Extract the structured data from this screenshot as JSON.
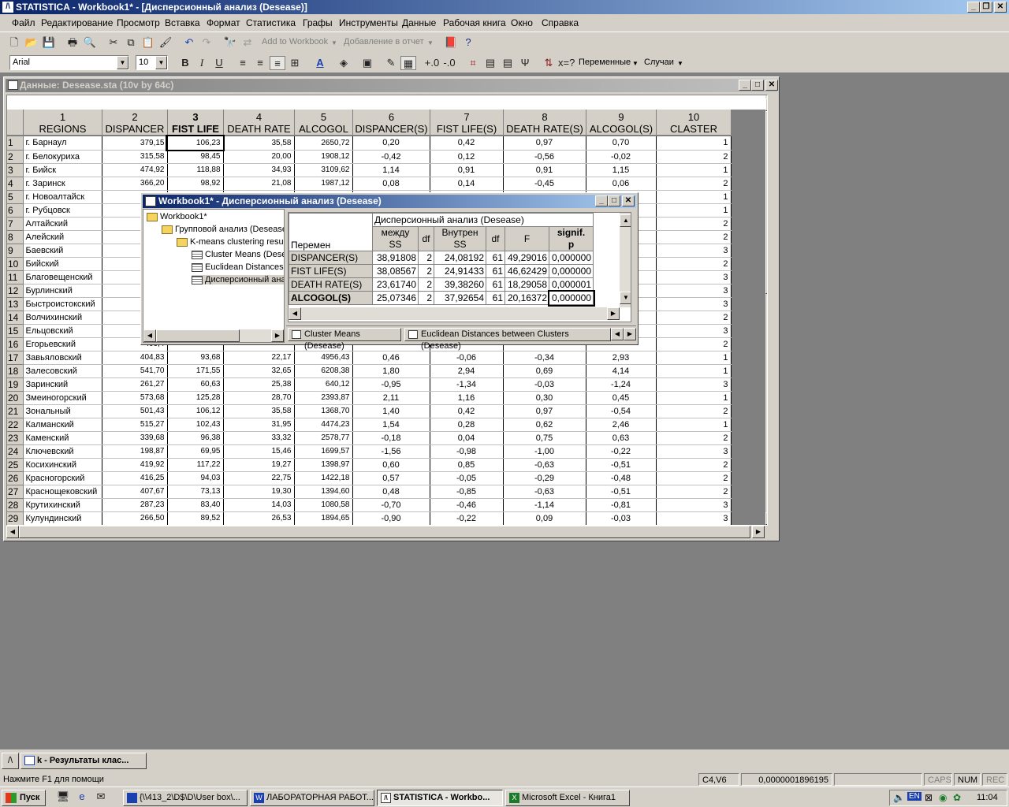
{
  "app": {
    "title": "STATISTICA - Workbook1* - [Дисперсионный анализ (Desease)]",
    "status_message": "Нажмите F1 для помощи",
    "status_cell": "C4,V6",
    "status_value": "0,0000001896195",
    "caps": "CAPS",
    "num": "NUM",
    "rec": "REC"
  },
  "menu": [
    "Файл",
    "Редактирование",
    "Просмотр",
    "Вставка",
    "Формат",
    "Статистика",
    "Графы",
    "Инструменты",
    "Данные",
    "Рабочая книга",
    "Окно",
    "Справка"
  ],
  "toolbar": {
    "add_to_workbook": "Add to Workbook",
    "add_to_report": "Добавление в отчет",
    "font": "Arial",
    "font_size": "10",
    "variables": "Переменные",
    "cases": "Случаи",
    "bold": "B",
    "italic": "I",
    "underline": "U"
  },
  "datasheet": {
    "title": "Данные: Desease.sta (10v by 64c)",
    "columns": [
      {
        "num": "1",
        "name": "REGIONS"
      },
      {
        "num": "2",
        "name": "DISPANCER"
      },
      {
        "num": "3",
        "name": "FIST LIFE"
      },
      {
        "num": "4",
        "name": "DEATH RATE"
      },
      {
        "num": "5",
        "name": "ALCOGOL"
      },
      {
        "num": "6",
        "name": "DISPANCER(S)"
      },
      {
        "num": "7",
        "name": "FIST LIFE(S)"
      },
      {
        "num": "8",
        "name": "DEATH RATE(S)"
      },
      {
        "num": "9",
        "name": "ALCOGOL(S)"
      },
      {
        "num": "10",
        "name": "CLASTER"
      }
    ],
    "rows": [
      [
        "1",
        "г. Барнаул",
        "379,15",
        "106,23",
        "35,58",
        "2650,72",
        "0,20",
        "0,42",
        "0,97",
        "0,70",
        "1"
      ],
      [
        "2",
        "г. Белокуриха",
        "315,58",
        "98,45",
        "20,00",
        "1908,12",
        "-0,42",
        "0,12",
        "-0,56",
        "-0,02",
        "2"
      ],
      [
        "3",
        "г. Бийск",
        "474,92",
        "118,88",
        "34,93",
        "3109,62",
        "1,14",
        "0,91",
        "0,91",
        "1,15",
        "1"
      ],
      [
        "4",
        "г. Заринск",
        "366,20",
        "98,92",
        "21,08",
        "1987,12",
        "0,08",
        "0,14",
        "-0,45",
        "0,06",
        "2"
      ],
      [
        "5",
        "г. Новоалтайск",
        "426,8",
        "",
        "",
        "",
        "",
        "",
        "",
        "",
        "1"
      ],
      [
        "6",
        "г. Рубцовск",
        "377,0",
        "",
        "",
        "",
        "",
        "",
        "",
        "",
        "1"
      ],
      [
        "7",
        "Алтайский",
        "399,6",
        "",
        "",
        "",
        "",
        "",
        "",
        "",
        "2"
      ],
      [
        "8",
        "Алейский",
        "401,9",
        "",
        "",
        "",
        "",
        "",
        "",
        "",
        "2"
      ],
      [
        "9",
        "Баевский",
        "298,7",
        "",
        "",
        "",
        "",
        "",
        "",
        "",
        "3"
      ],
      [
        "10",
        "Бийский",
        "399,8",
        "",
        "",
        "",
        "",
        "",
        "",
        "",
        "2"
      ],
      [
        "11",
        "Благовещенский",
        "300,7",
        "",
        "",
        "",
        "",
        "",
        "",
        "",
        "3"
      ],
      [
        "12",
        "Бурлинский",
        "211,0",
        "",
        "",
        "",
        "",
        "",
        "",
        "",
        "3"
      ],
      [
        "13",
        "Быстроистокский",
        "325,9",
        "",
        "",
        "",
        "",
        "",
        "",
        "",
        "3"
      ],
      [
        "14",
        "Волчихинский",
        "313,8",
        "",
        "",
        "",
        "",
        "",
        "",
        "",
        "2"
      ],
      [
        "15",
        "Ельцовский",
        "239,4",
        "",
        "",
        "",
        "",
        "",
        "",
        "",
        "3"
      ],
      [
        "16",
        "Егорьевский",
        "409,4",
        "",
        "",
        "",
        "",
        "",
        "",
        "",
        "2"
      ],
      [
        "17",
        "Завьяловский",
        "404,83",
        "93,68",
        "22,17",
        "4956,43",
        "0,46",
        "-0,06",
        "-0,34",
        "2,93",
        "1"
      ],
      [
        "18",
        "Залесовский",
        "541,70",
        "171,55",
        "32,65",
        "6208,38",
        "1,80",
        "2,94",
        "0,69",
        "4,14",
        "1"
      ],
      [
        "19",
        "Заринский",
        "261,27",
        "60,63",
        "25,38",
        "640,12",
        "-0,95",
        "-1,34",
        "-0,03",
        "-1,24",
        "3"
      ],
      [
        "20",
        "Змеиногорский",
        "573,68",
        "125,28",
        "28,70",
        "2393,87",
        "2,11",
        "1,16",
        "0,30",
        "0,45",
        "1"
      ],
      [
        "21",
        "Зональный",
        "501,43",
        "106,12",
        "35,58",
        "1368,70",
        "1,40",
        "0,42",
        "0,97",
        "-0,54",
        "2"
      ],
      [
        "22",
        "Калманский",
        "515,27",
        "102,43",
        "31,95",
        "4474,23",
        "1,54",
        "0,28",
        "0,62",
        "2,46",
        "1"
      ],
      [
        "23",
        "Каменский",
        "339,68",
        "96,38",
        "33,32",
        "2578,77",
        "-0,18",
        "0,04",
        "0,75",
        "0,63",
        "2"
      ],
      [
        "24",
        "Ключевский",
        "198,87",
        "69,95",
        "15,46",
        "1699,57",
        "-1,56",
        "-0,98",
        "-1,00",
        "-0,22",
        "3"
      ],
      [
        "25",
        "Косихинский",
        "419,92",
        "117,22",
        "19,27",
        "1398,97",
        "0,60",
        "0,85",
        "-0,63",
        "-0,51",
        "2"
      ],
      [
        "26",
        "Красногорский",
        "416,25",
        "94,03",
        "22,75",
        "1422,18",
        "0,57",
        "-0,05",
        "-0,29",
        "-0,48",
        "2"
      ],
      [
        "27",
        "Краснощековский",
        "407,67",
        "73,13",
        "19,30",
        "1394,60",
        "0,48",
        "-0,85",
        "-0,63",
        "-0,51",
        "2"
      ],
      [
        "28",
        "Крутихинский",
        "287,23",
        "83,40",
        "14,03",
        "1080,58",
        "-0,70",
        "-0,46",
        "-1,14",
        "-0,81",
        "3"
      ],
      [
        "29",
        "Кулундинский",
        "266,50",
        "89,52",
        "26,53",
        "1894,65",
        "-0,90",
        "-0,22",
        "0,09",
        "-0,03",
        "3"
      ]
    ]
  },
  "workbook": {
    "title": "Workbook1* - Дисперсионный анализ (Desease)",
    "tree": [
      {
        "label": "Workbook1*",
        "level": 0,
        "icon": "folder-icon"
      },
      {
        "label": "Групповой анализ (Desease",
        "level": 1,
        "icon": "folder-icon"
      },
      {
        "label": "K-means clustering result",
        "level": 2,
        "icon": "folder-icon"
      },
      {
        "label": "Cluster Means (Dese",
        "level": 3,
        "icon": "sheet-icon"
      },
      {
        "label": "Euclidean Distances b",
        "level": 3,
        "icon": "sheet-icon"
      },
      {
        "label": "Дисперсионный ана",
        "level": 3,
        "icon": "sheet-icon"
      }
    ],
    "result": {
      "caption": "Дисперсионный анализ (Desease)",
      "row_header": "Перемен",
      "headers": [
        {
          "top": "между",
          "bottom": "SS"
        },
        {
          "top": "df",
          "bottom": ""
        },
        {
          "top": "Внутрен",
          "bottom": "SS"
        },
        {
          "top": "df",
          "bottom": ""
        },
        {
          "top": "F",
          "bottom": ""
        },
        {
          "top": "signif.",
          "bottom": "p"
        }
      ],
      "rows": [
        [
          "DISPANCER(S)",
          "38,91808",
          "2",
          "24,08192",
          "61",
          "49,29016",
          "0,000000"
        ],
        [
          "FIST LIFE(S)",
          "38,08567",
          "2",
          "24,91433",
          "61",
          "46,62429",
          "0,000000"
        ],
        [
          "DEATH RATE(S)",
          "23,61740",
          "2",
          "39,38260",
          "61",
          "18,29058",
          "0,000001"
        ],
        [
          "ALCOGOL(S)",
          "25,07346",
          "2",
          "37,92654",
          "61",
          "20,16372",
          "0,000000"
        ]
      ]
    },
    "tabs": [
      "Cluster Means (Desease)",
      "Euclidean Distances between Clusters (Desease)"
    ]
  },
  "workbook_button": "k - Результаты клас...",
  "taskbar": {
    "start": "Пуск",
    "tasks": [
      "{\\\\413_2\\D$\\D\\User box\\...",
      "ЛАБОРАТОРНАЯ РАБОТ...",
      "STATISTICA - Workbo...",
      "Microsoft Excel - Книга1"
    ],
    "lang": "EN",
    "clock": "11:04"
  }
}
